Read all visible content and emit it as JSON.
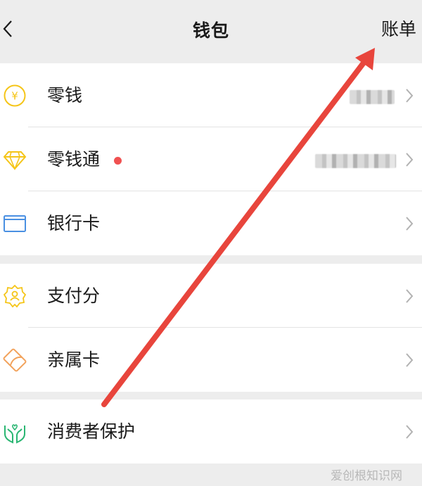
{
  "nav": {
    "title": "钱包",
    "bill_label": "账单"
  },
  "groups": [
    {
      "items": [
        {
          "label": "零钱",
          "icon": "yen-coin-icon"
        },
        {
          "label": "零钱通",
          "icon": "diamond-icon",
          "dot": true
        },
        {
          "label": "银行卡",
          "icon": "bank-card-icon"
        }
      ]
    },
    {
      "items": [
        {
          "label": "支付分",
          "icon": "pay-score-badge-icon"
        },
        {
          "label": "亲属卡",
          "icon": "family-card-icon"
        }
      ]
    },
    {
      "items": [
        {
          "label": "消费者保护",
          "icon": "hands-protect-icon"
        }
      ]
    }
  ],
  "watermark": "爱创根知识网",
  "colors": {
    "accent_yellow": "#f5c518",
    "card_blue": "#4a90e2",
    "orange": "#f2a25b",
    "green": "#2bb673",
    "arrow_red": "#e8453c",
    "dot_red": "#f05151"
  }
}
